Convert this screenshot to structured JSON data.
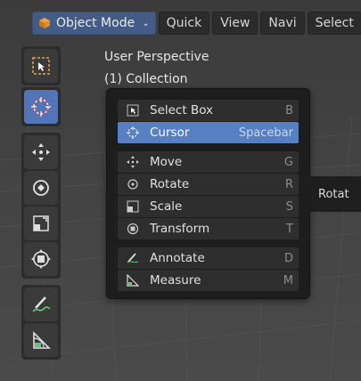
{
  "header": {
    "mode_label": "Object Mode",
    "buttons": [
      "Quick",
      "View",
      "Navi",
      "Select"
    ]
  },
  "overlay": {
    "perspective": "User Perspective",
    "collection": "(1) Collection"
  },
  "toolbar": {
    "tools": [
      "select-box",
      "cursor",
      "move",
      "rotate",
      "scale",
      "transform",
      "annotate",
      "measure"
    ],
    "active_tool": "cursor"
  },
  "menu": {
    "group1": [
      {
        "label": "Select Box",
        "shortcut": "B",
        "icon": "select-box-icon"
      },
      {
        "label": "Cursor",
        "shortcut": "Spacebar",
        "icon": "cursor-icon",
        "selected": true
      }
    ],
    "group2": [
      {
        "label": "Move",
        "shortcut": "G",
        "icon": "move-icon"
      },
      {
        "label": "Rotate",
        "shortcut": "R",
        "icon": "rotate-icon"
      },
      {
        "label": "Scale",
        "shortcut": "S",
        "icon": "scale-icon"
      },
      {
        "label": "Transform",
        "shortcut": "T",
        "icon": "transform-icon"
      }
    ],
    "group3": [
      {
        "label": "Annotate",
        "shortcut": "D",
        "icon": "annotate-icon"
      },
      {
        "label": "Measure",
        "shortcut": "M",
        "icon": "measure-icon"
      }
    ]
  },
  "tooltip": {
    "text": "Rotat"
  },
  "colors": {
    "accent": "#5680c2",
    "mode": "#445b86",
    "menu_bg": "#1d1d1d"
  }
}
